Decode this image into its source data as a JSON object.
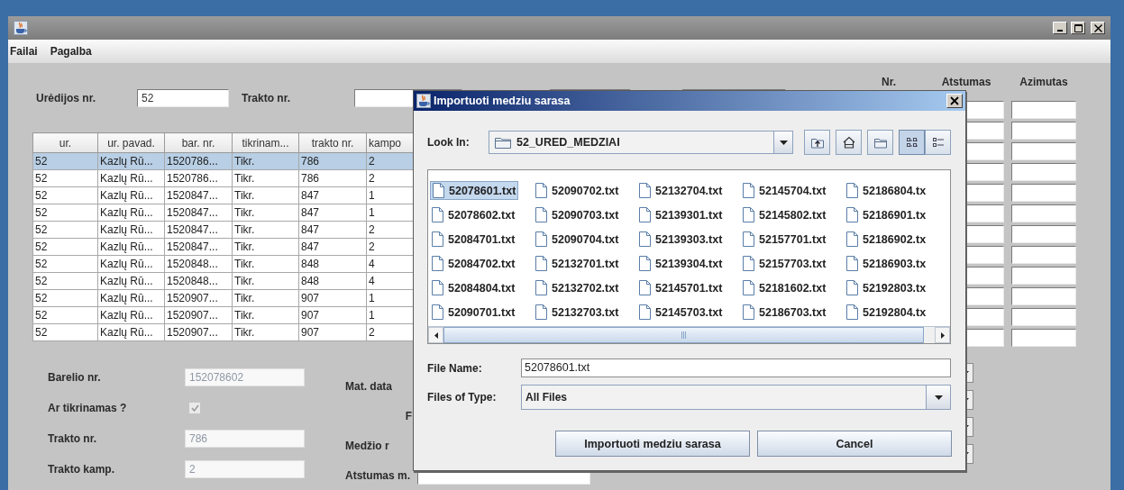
{
  "window": {
    "menu": [
      "Failai",
      "Pagalba"
    ]
  },
  "filter": {
    "uredijos_label": "Urėdijos nr.",
    "uredijos_value": "52",
    "trakto_label": "Trakto nr."
  },
  "table": {
    "columns": [
      "ur.",
      "ur. pavad.",
      "bar. nr.",
      "tikrinam...",
      "trakto nr.",
      "kampo"
    ],
    "rows": [
      {
        "cells": [
          "52",
          "Kazlų Rū...",
          "1520786...",
          "Tikr.",
          "786",
          "2"
        ],
        "selected": true
      },
      {
        "cells": [
          "52",
          "Kazlų Rū...",
          "1520786...",
          "Tikr.",
          "786",
          "2"
        ],
        "selected": false
      },
      {
        "cells": [
          "52",
          "Kazlų Rū...",
          "1520847...",
          "Tikr.",
          "847",
          "1"
        ],
        "selected": false
      },
      {
        "cells": [
          "52",
          "Kazlų Rū...",
          "1520847...",
          "Tikr.",
          "847",
          "1"
        ],
        "selected": false
      },
      {
        "cells": [
          "52",
          "Kazlų Rū...",
          "1520847...",
          "Tikr.",
          "847",
          "2"
        ],
        "selected": false
      },
      {
        "cells": [
          "52",
          "Kazlų Rū...",
          "1520847...",
          "Tikr.",
          "847",
          "2"
        ],
        "selected": false
      },
      {
        "cells": [
          "52",
          "Kazlų Rū...",
          "1520848...",
          "Tikr.",
          "848",
          "4"
        ],
        "selected": false
      },
      {
        "cells": [
          "52",
          "Kazlų Rū...",
          "1520848...",
          "Tikr.",
          "848",
          "4"
        ],
        "selected": false
      },
      {
        "cells": [
          "52",
          "Kazlų Rū...",
          "1520907...",
          "Tikr.",
          "907",
          "1"
        ],
        "selected": false
      },
      {
        "cells": [
          "52",
          "Kazlų Rū...",
          "1520907...",
          "Tikr.",
          "907",
          "1"
        ],
        "selected": false
      },
      {
        "cells": [
          "52",
          "Kazlų Rū...",
          "1520907...",
          "Tikr.",
          "907",
          "2"
        ],
        "selected": false
      }
    ]
  },
  "form": {
    "fields": [
      {
        "kind": "text",
        "label": "Barelio nr.",
        "value": "152078602",
        "disabled": true
      },
      {
        "kind": "checkbox",
        "label": "Ar tikrinamas ?",
        "checked": true,
        "disabled": true
      },
      {
        "kind": "text",
        "label": "Trakto nr.",
        "value": "786",
        "disabled": true
      },
      {
        "kind": "text",
        "label": "Trakto kamp.",
        "value": "2",
        "disabled": true
      }
    ]
  },
  "middle_form": {
    "labels": [
      "Mat. data",
      "F",
      "Medžio r"
    ],
    "distance_label": "Atstumas m."
  },
  "points": {
    "columns": [
      "Nr.",
      "Atstumas",
      "Azimutas"
    ]
  },
  "dialog": {
    "title": "Importuoti medziu sarasa",
    "look_in_label": "Look In:",
    "look_in_value": "52_URED_MEDZIAI",
    "toolbar": [
      {
        "kind": "up",
        "selected": false
      },
      {
        "kind": "home",
        "selected": false
      },
      {
        "kind": "new-folder",
        "selected": false
      },
      {
        "kind": "list",
        "selected": true
      },
      {
        "kind": "details",
        "selected": false
      }
    ],
    "files": [
      {
        "name": "52078601.txt",
        "selected": true
      },
      {
        "name": "52078602.txt",
        "selected": false
      },
      {
        "name": "52084701.txt",
        "selected": false
      },
      {
        "name": "52084702.txt",
        "selected": false
      },
      {
        "name": "52084804.txt",
        "selected": false
      },
      {
        "name": "52090701.txt",
        "selected": false
      },
      {
        "name": "52090702.txt",
        "selected": false
      },
      {
        "name": "52090703.txt",
        "selected": false
      },
      {
        "name": "52090704.txt",
        "selected": false
      },
      {
        "name": "52132701.txt",
        "selected": false
      },
      {
        "name": "52132702.txt",
        "selected": false
      },
      {
        "name": "52132703.txt",
        "selected": false
      },
      {
        "name": "52132704.txt",
        "selected": false
      },
      {
        "name": "52139301.txt",
        "selected": false
      },
      {
        "name": "52139303.txt",
        "selected": false
      },
      {
        "name": "52139304.txt",
        "selected": false
      },
      {
        "name": "52145701.txt",
        "selected": false
      },
      {
        "name": "52145703.txt",
        "selected": false
      },
      {
        "name": "52145704.txt",
        "selected": false
      },
      {
        "name": "52145802.txt",
        "selected": false
      },
      {
        "name": "52157701.txt",
        "selected": false
      },
      {
        "name": "52157703.txt",
        "selected": false
      },
      {
        "name": "52181602.txt",
        "selected": false
      },
      {
        "name": "52186703.txt",
        "selected": false
      },
      {
        "name": "52186804.tx",
        "selected": false
      },
      {
        "name": "52186901.tx",
        "selected": false
      },
      {
        "name": "52186902.tx",
        "selected": false
      },
      {
        "name": "52186903.tx",
        "selected": false
      },
      {
        "name": "52192803.tx",
        "selected": false
      },
      {
        "name": "52192804.tx",
        "selected": false
      }
    ],
    "file_name_label": "File Name:",
    "file_name_value": "52078601.txt",
    "file_type_label": "Files of Type:",
    "file_type_value": "All Files",
    "buttons": [
      "Importuoti medziu sarasa",
      "Cancel"
    ]
  }
}
